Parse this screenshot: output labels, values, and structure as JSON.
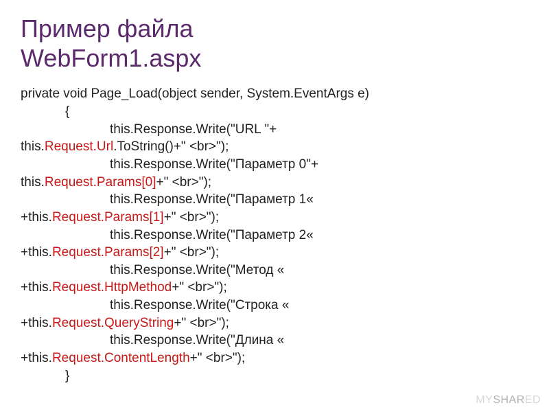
{
  "title_line1": "Пример файла",
  "title_line2": "WebForm1.aspx",
  "code": {
    "sig": "private void Page_Load(object sender, System.EventArgs e)",
    "brace_open": "{",
    "brace_close": "}",
    "l1a": "this.Response.Write(\"URL \"+",
    "l1b_pre": "this.",
    "l1b_red": "Request.Url",
    "l1b_post": ".ToString()+\" <br>\");",
    "l2a": "this.Response.Write(\"Параметр 0\"+",
    "l2b_pre": "this.",
    "l2b_red": "Request.Params[0]",
    "l2b_post": "+\" <br>\");",
    "l3a": "this.Response.Write(\"Параметр 1«",
    "l3b_pre": "+this.",
    "l3b_red": "Request.Params[1]",
    "l3b_post": "+\" <br>\");",
    "l4a": "this.Response.Write(\"Параметр 2«",
    "l4b_pre": "+this.",
    "l4b_red": "Request.Params[2]",
    "l4b_post": "+\" <br>\");",
    "l5a": "this.Response.Write(\"Метод «",
    "l5b_pre": "+this.",
    "l5b_red": "Request.HttpMethod",
    "l5b_post": "+\" <br>\");",
    "l6a": "this.Response.Write(\"Строка «",
    "l6b_pre": "+this.",
    "l6b_red": "Request.QueryString",
    "l6b_post": "+\" <br>\");",
    "l7a": "this.Response.Write(\"Длина «",
    "l7b_pre": "+this.",
    "l7b_red": "Request.ContentLength",
    "l7b_post": "+\" <br>\");"
  },
  "watermark_pre": "MY",
  "watermark_mid": "SHAR",
  "watermark_post": "ED"
}
